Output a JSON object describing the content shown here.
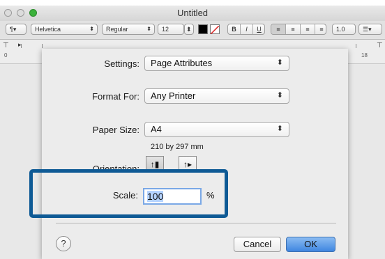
{
  "window": {
    "title": "Untitled"
  },
  "toolbar": {
    "paragraph_style": "¶▾",
    "font_family": "Helvetica",
    "font_style": "Regular",
    "font_size": "12",
    "bold_label": "B",
    "italic_label": "I",
    "underline_label": "U",
    "line_spacing": "1.0",
    "list_style": "☰▾",
    "text_color": "#000000"
  },
  "ruler": {
    "start": "0",
    "end": "18"
  },
  "dialog": {
    "settings": {
      "label": "Settings:",
      "value": "Page Attributes"
    },
    "format_for": {
      "label": "Format For:",
      "value": "Any Printer"
    },
    "paper_size": {
      "label": "Paper Size:",
      "value": "A4",
      "dimensions": "210 by 297 mm"
    },
    "orientation": {
      "label": "Orientation:"
    },
    "scale": {
      "label": "Scale:",
      "value": "100",
      "unit": "%"
    },
    "help_label": "?",
    "cancel_label": "Cancel",
    "ok_label": "OK"
  },
  "colors": {
    "highlight": "#0e5a95",
    "ok_button": "#3f86e0",
    "zoom_button": "#3cb23c"
  }
}
